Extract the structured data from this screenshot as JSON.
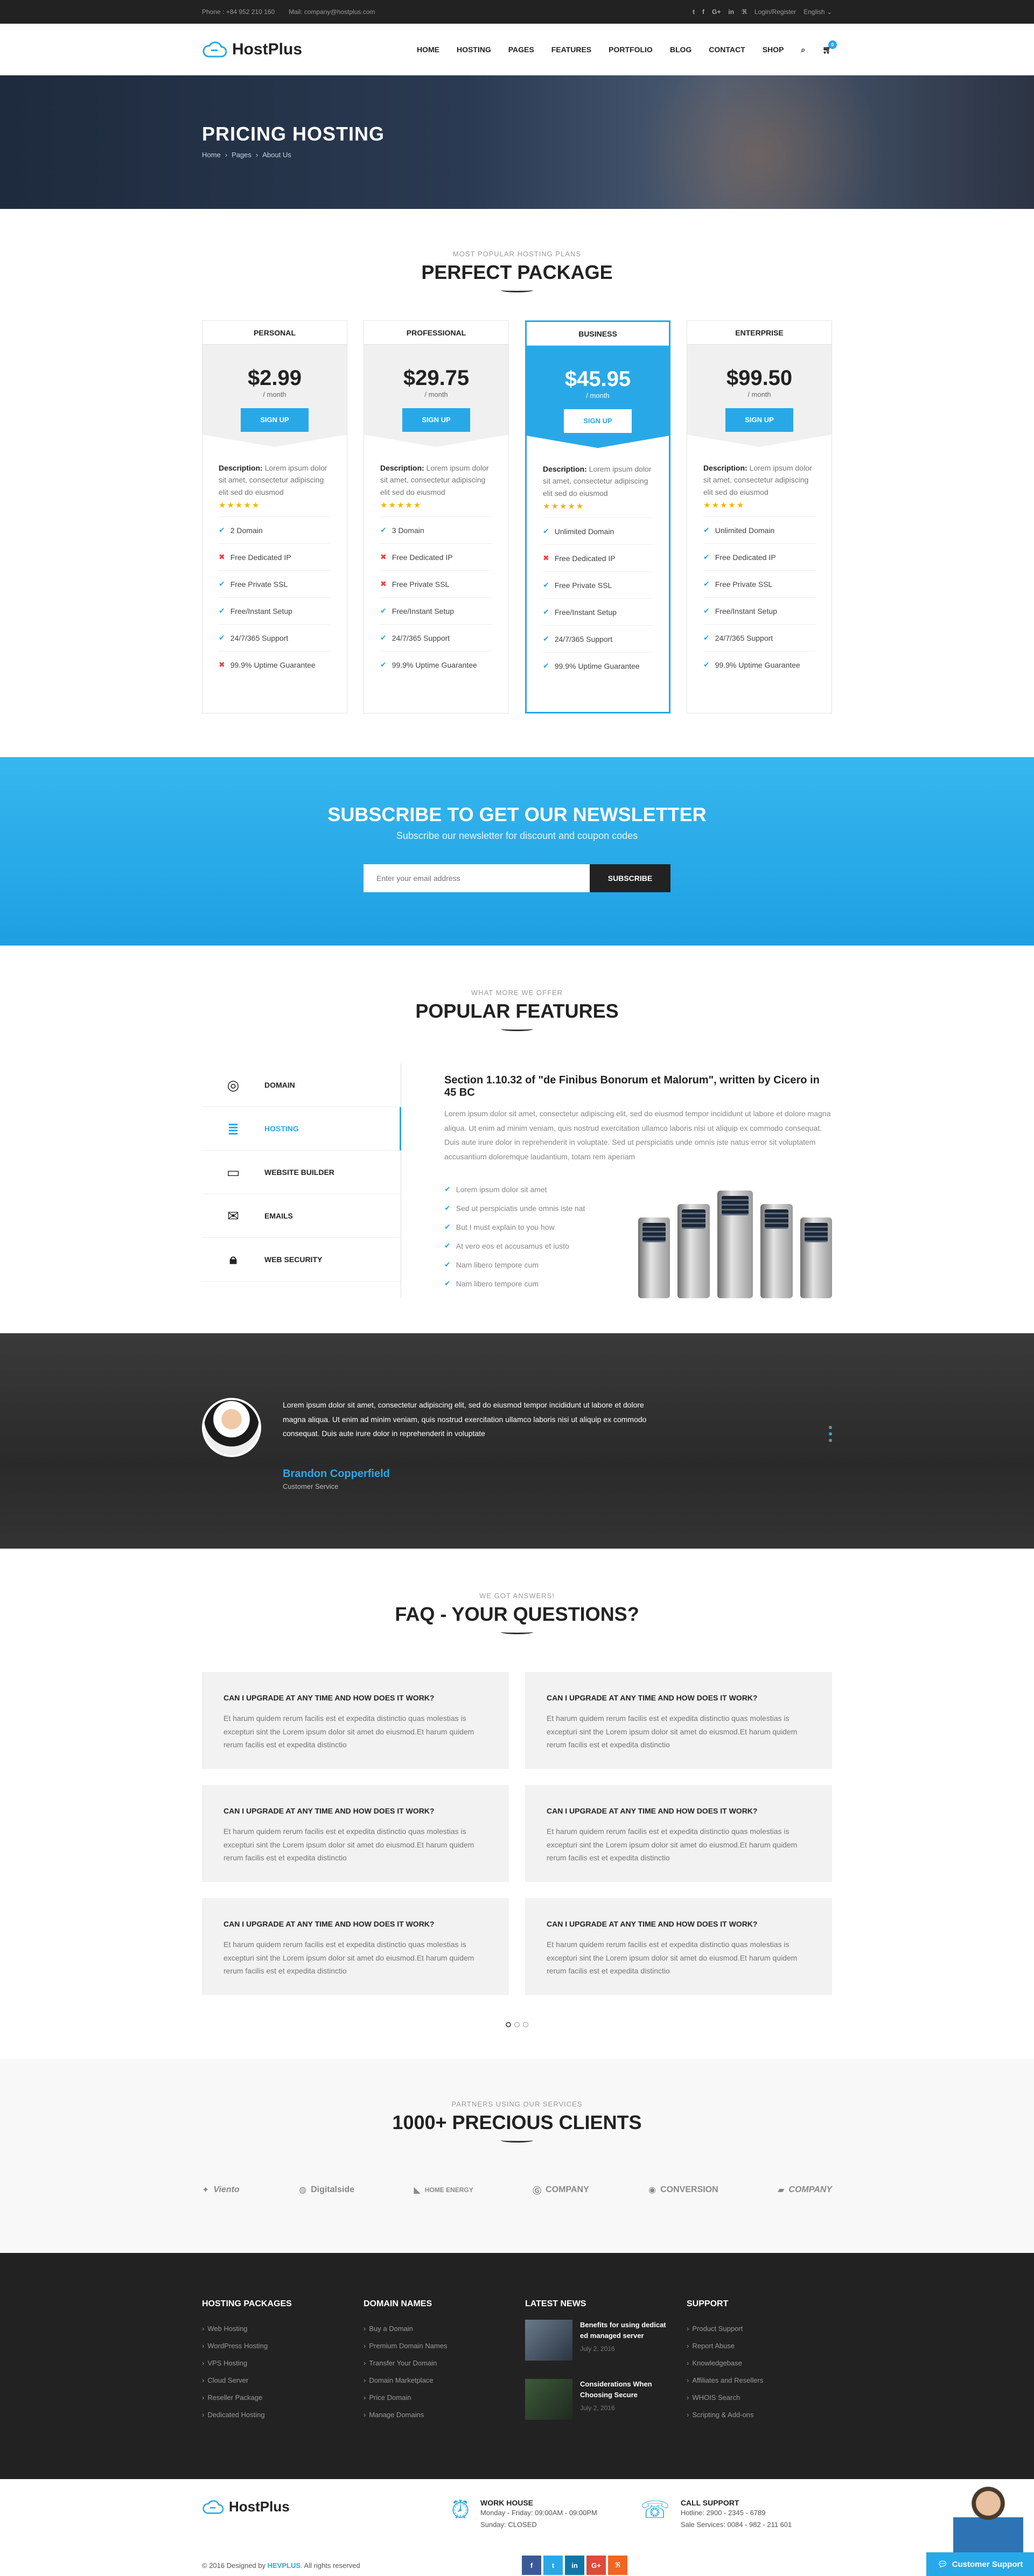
{
  "topbar": {
    "phone": "Phone : +84 952 210 160",
    "mail": "Mail: company@hostplus.com",
    "socials": [
      "t",
      "f",
      "G+",
      "in",
      "ℜ"
    ],
    "login": "Login/Register",
    "language": "English"
  },
  "header": {
    "logo": "HostPlus",
    "nav": [
      "HOME",
      "HOSTING",
      "PAGES",
      "FEATURES",
      "PORTFOLIO",
      "BLOG",
      "CONTACT",
      "SHOP"
    ],
    "cart_count": "0"
  },
  "hero": {
    "title": "PRICING HOSTING",
    "breadcrumb": [
      "Home",
      "Pages",
      "About Us"
    ]
  },
  "pricing": {
    "subtitle": "MOST POPULAR HOSTING PLANS",
    "title": "PERFECT PACKAGE",
    "description_label": "Description:",
    "description_text": " Lorem ipsum dolor sit amet, consectetur adipiscing elit sed do eiusmod",
    "stars": "★★★★★",
    "per": "/ month",
    "button": "SIGN UP",
    "plans": [
      {
        "name": "PERSONAL",
        "price": "$2.99",
        "features": [
          [
            "ok",
            "2 Domain"
          ],
          [
            "no",
            "Free Dedicated IP"
          ],
          [
            "ok",
            "Free Private SSL"
          ],
          [
            "ok",
            "Free/Instant Setup"
          ],
          [
            "ok",
            "24/7/365 Support"
          ],
          [
            "no",
            "99.9% Uptime Guarantee"
          ]
        ]
      },
      {
        "name": "PROFESSIONAL",
        "price": "$29.75",
        "features": [
          [
            "ok",
            "3 Domain"
          ],
          [
            "no",
            "Free Dedicated IP"
          ],
          [
            "no",
            "Free Private SSL"
          ],
          [
            "ok",
            "Free/Instant Setup"
          ],
          [
            "ok",
            "24/7/365 Support"
          ],
          [
            "ok",
            "99.9% Uptime Guarantee"
          ]
        ]
      },
      {
        "name": "BUSINESS",
        "price": "$45.95",
        "features": [
          [
            "ok",
            "Unlimited Domain"
          ],
          [
            "no",
            "Free Dedicated IP"
          ],
          [
            "ok",
            "Free Private SSL"
          ],
          [
            "ok",
            "Free/Instant Setup"
          ],
          [
            "ok",
            "24/7/365 Support"
          ],
          [
            "ok",
            "99.9% Uptime Guarantee"
          ]
        ]
      },
      {
        "name": "ENTERPRISE",
        "price": "$99.50",
        "features": [
          [
            "ok",
            "Unlimited Domain"
          ],
          [
            "ok",
            "Free Dedicated IP"
          ],
          [
            "ok",
            "Free Private SSL"
          ],
          [
            "ok",
            "Free/Instant Setup"
          ],
          [
            "ok",
            "24/7/365 Support"
          ],
          [
            "ok",
            "99.9% Uptime Guarantee"
          ]
        ]
      }
    ]
  },
  "newsletter": {
    "title": "SUBSCRIBE TO GET OUR NEWSLETTER",
    "subtitle": "Subscribe our newsletter for discount and coupon codes",
    "placeholder": "Enter your email address",
    "button": "SUBSCRIBE"
  },
  "features": {
    "subtitle": "WHAT MORE WE OFFER",
    "title": "POPULAR FEATURES",
    "tabs": [
      {
        "label": "DOMAIN",
        "icon": "◎"
      },
      {
        "label": "HOSTING",
        "icon": "≣"
      },
      {
        "label": "WEBSITE BUILDER",
        "icon": "▭"
      },
      {
        "label": "EMAILS",
        "icon": "✉"
      },
      {
        "label": "WEB SECURITY",
        "icon": "🔒︎"
      }
    ],
    "active_tab": 1,
    "heading": "Section 1.10.32 of \"de Finibus Bonorum et Malorum\", written by Cicero in 45 BC",
    "body": "Lorem ipsum dolor sit amet, consectetur adipiscing elit, sed do eiusmod tempor incididunt ut labore et dolore magna aliqua. Ut enim ad minim veniam, quis nostrud exercitation ullamco laboris nisi ut aliquip ex commodo consequat. Duis aute irure dolor in reprehenderit in voluptate. Sed ut perspiciatis unde omnis iste natus error sit voluptatem accusantium doloremque laudantium, totam rem aperiam",
    "checks": [
      "Lorem ipsum dolor sit amet",
      "Sed ut perspiciatis unde omnis iste nat",
      "But I must explain to you how",
      "At vero eos et accusamus et iusto",
      "Nam libero tempore cum",
      "Nam libero tempore cum"
    ]
  },
  "testimonial": {
    "quote": "Lorem ipsum dolor sit amet, consectetur adipiscing elit, sed do eiusmod tempor incididunt ut labore et dolore magna aliqua. Ut enim ad minim veniam, quis nostrud exercitation ullamco laboris nisi ut aliquip ex commodo consequat. Duis aute irure dolor in reprehenderit in voluptate",
    "name": "Brandon Copperfield",
    "role": "Customer Service"
  },
  "faq": {
    "subtitle": "WE GOT ANSWERS!",
    "title": "FAQ - YOUR QUESTIONS?",
    "question": "CAN I UPGRADE AT ANY TIME AND HOW DOES IT WORK?",
    "answer": "Et harum quidem rerum facilis est et expedita distinctio quas molestias is excepturi sint the Lorem ipsum dolor sit amet do eiusmod.Et harum quidem rerum facilis est et expedita distinctio"
  },
  "clients": {
    "subtitle": "PARTNERS USING OUR SERVICES",
    "title": "1000+ PRECIOUS CLIENTS",
    "logos": [
      "Viento",
      "Digitalside",
      "HOME ENERGY",
      "COMPANY",
      "CONVERSION",
      "COMPANY"
    ]
  },
  "footer": {
    "hosting_title": "HOSTING PACKAGES",
    "hosting": [
      "Web Hosting",
      "WordPress Hosting",
      "VPS Hosting",
      "Cloud Server",
      "Reseller Package",
      "Dedicated Hosting"
    ],
    "domain_title": "DOMAIN NAMES",
    "domain": [
      "Buy a Domain",
      "Premium Domain Names",
      "Transfer Your Domain",
      "Domain Marketplace",
      "Price Domain",
      "Manage Domains"
    ],
    "news_title": "LATEST NEWS",
    "news": [
      {
        "title": "Benefits for using dedicat ed managed server",
        "date": "July 2, 2016"
      },
      {
        "title": "Considerations When Choosing Secure",
        "date": "July 2, 2016"
      }
    ],
    "support_title": "SUPPORT",
    "support": [
      "Product Support",
      "Report Abuse",
      "Knowledgebase",
      "Affiliates and Resellers",
      "WHOIS Search",
      "Scripting & Add-ons"
    ]
  },
  "bottom": {
    "logo": "HostPlus",
    "work_title": "WORK HOUSE",
    "work_1": "Monday - Friday: 09:00AM - 09:00PM",
    "work_2": "Sunday: CLOSED",
    "call_title": "CALL SUPPORT",
    "call_1": "Hotline: 2900 - 2345 - 6789",
    "call_2": "Sale Services: 0084 - 982 - 211 601",
    "copyright_pre": "© 2016 Designed by ",
    "copyright_brand": "HEVPLUS",
    "copyright_post": ". All rights reserved",
    "socials": [
      "f",
      "t",
      "in",
      "G+",
      "ℜ"
    ],
    "support_btn": "Customer Support"
  },
  "colors": {
    "accent": "#29a8e8",
    "dark": "#222222",
    "error": "#e84040",
    "star": "#f5b400"
  }
}
